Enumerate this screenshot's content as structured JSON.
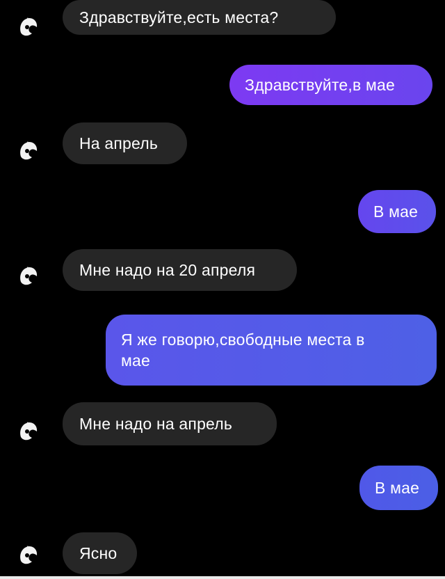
{
  "colors": {
    "background": "#000000",
    "incoming_bubble": "#262626",
    "outgoing_gradient_start": "#7a3df0",
    "outgoing_gradient_end": "#4f5fe8",
    "text": "#ffffff"
  },
  "chat": {
    "avatar_icon": "avatar-icon",
    "messages": [
      {
        "from": "contact",
        "text": "Здравствуйте,есть места?"
      },
      {
        "from": "me",
        "text": "Здравствуйте,в мае"
      },
      {
        "from": "contact",
        "text": "На апрель"
      },
      {
        "from": "me",
        "text": "В мае"
      },
      {
        "from": "contact",
        "text": "Мне надо на 20 апреля"
      },
      {
        "from": "me",
        "text": "Я же говорю,свободные места в мае",
        "line1": "Я же говорю,свободные места в",
        "line2": "мае"
      },
      {
        "from": "contact",
        "text": "Мне надо на апрель"
      },
      {
        "from": "me",
        "text": "В мае"
      },
      {
        "from": "contact",
        "text": "Ясно"
      }
    ]
  }
}
